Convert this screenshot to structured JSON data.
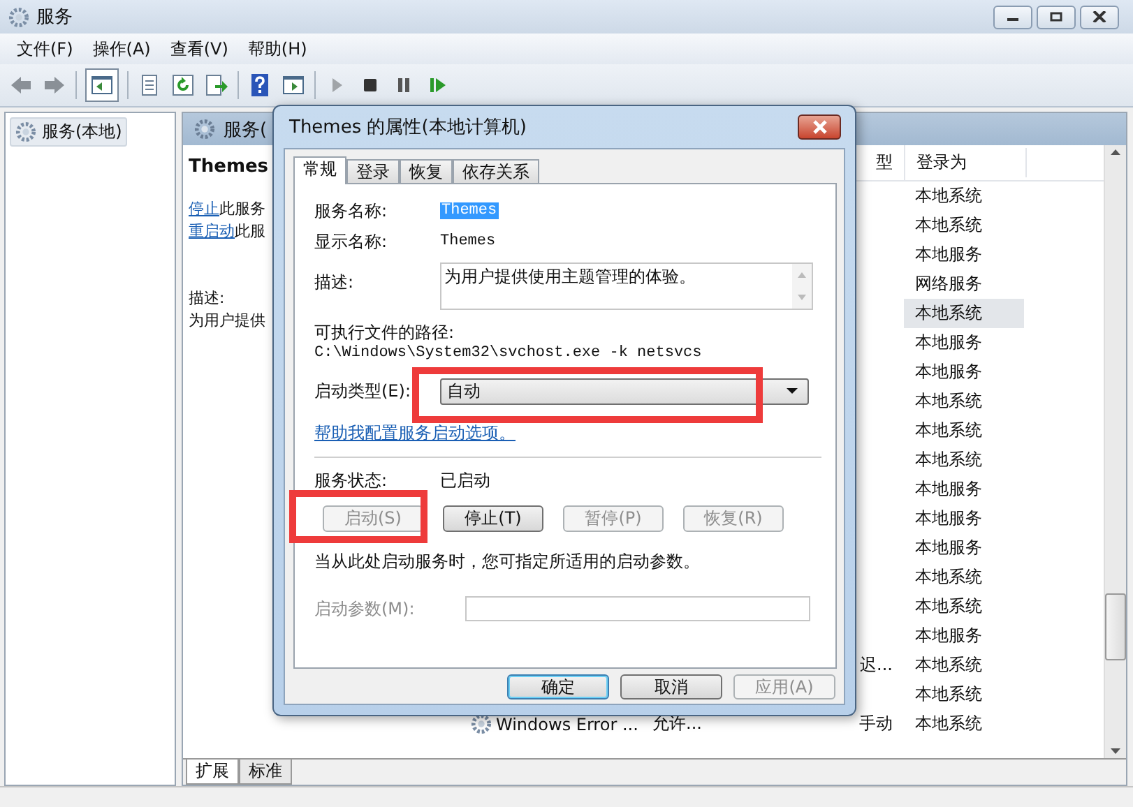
{
  "window": {
    "title": "服务"
  },
  "menu": [
    "文件(F)",
    "操作(A)",
    "查看(V)",
    "帮助(H)"
  ],
  "tree": {
    "items": [
      {
        "label": "服务(本地)",
        "selected": true
      }
    ]
  },
  "panel": {
    "header": "服务(",
    "service_title": "Themes",
    "actions": [
      {
        "link": "停止",
        "text": "此服务"
      },
      {
        "link": "重启动",
        "text": "此服"
      }
    ],
    "description_label": "描述:",
    "description": "为用户提供"
  },
  "list": {
    "headers": {
      "startup_type": "型",
      "log_on_as": "登录为"
    },
    "rows": [
      {
        "log_on_as": "本地系统",
        "selected": false
      },
      {
        "log_on_as": "本地系统",
        "selected": false
      },
      {
        "log_on_as": "本地服务",
        "selected": false
      },
      {
        "log_on_as": "网络服务",
        "selected": false
      },
      {
        "log_on_as": "本地系统",
        "selected": true
      },
      {
        "log_on_as": "本地服务",
        "selected": false
      },
      {
        "log_on_as": "本地服务",
        "selected": false
      },
      {
        "log_on_as": "本地系统",
        "selected": false
      },
      {
        "log_on_as": "本地系统",
        "selected": false
      },
      {
        "log_on_as": "本地系统",
        "selected": false
      },
      {
        "log_on_as": "本地服务",
        "selected": false
      },
      {
        "log_on_as": "本地服务",
        "selected": false
      },
      {
        "log_on_as": "本地服务",
        "selected": false
      },
      {
        "log_on_as": "本地系统",
        "selected": false
      },
      {
        "log_on_as": "本地系统",
        "selected": false
      },
      {
        "log_on_as": "本地服务",
        "selected": false
      },
      {
        "startup_type": "迟...",
        "log_on_as": "本地系统",
        "selected": false
      },
      {
        "log_on_as": "本地系统",
        "selected": false
      },
      {
        "name": "Windows Error ...",
        "description": "允许...",
        "startup_type": "手动",
        "log_on_as": "本地系统",
        "selected": false
      }
    ]
  },
  "view_tabs": [
    {
      "label": "扩展",
      "selected": true
    },
    {
      "label": "标准",
      "selected": false
    }
  ],
  "dialog": {
    "title": "Themes 的属性(本地计算机)",
    "tabs": [
      {
        "label": "常规",
        "selected": true
      },
      {
        "label": "登录",
        "selected": false
      },
      {
        "label": "恢复",
        "selected": false
      },
      {
        "label": "依存关系",
        "selected": false
      }
    ],
    "service_name": {
      "label": "服务名称:",
      "value": "Themes"
    },
    "display_name": {
      "label": "显示名称:",
      "value": "Themes"
    },
    "description": {
      "label": "描述:",
      "value": "为用户提供使用主题管理的体验。"
    },
    "path": {
      "label": "可执行文件的路径:",
      "value": "C:\\Windows\\System32\\svchost.exe -k netsvcs"
    },
    "startup_type": {
      "label": "启动类型(E):",
      "value": "自动"
    },
    "help_link": "帮助我配置服务启动选项。",
    "status": {
      "label": "服务状态:",
      "value": "已启动"
    },
    "control_buttons": [
      {
        "label": "启动(S)",
        "disabled": true
      },
      {
        "label": "停止(T)",
        "disabled": false
      },
      {
        "label": "暂停(P)",
        "disabled": true
      },
      {
        "label": "恢复(R)",
        "disabled": true
      }
    ],
    "hint": "当从此处启动服务时，您可指定所适用的启动参数。",
    "params": {
      "label": "启动参数(M):",
      "disabled": true
    },
    "footer_buttons": [
      {
        "label": "确定",
        "disabled": false
      },
      {
        "label": "取消",
        "disabled": false
      },
      {
        "label": "应用(A)",
        "disabled": true
      }
    ]
  }
}
